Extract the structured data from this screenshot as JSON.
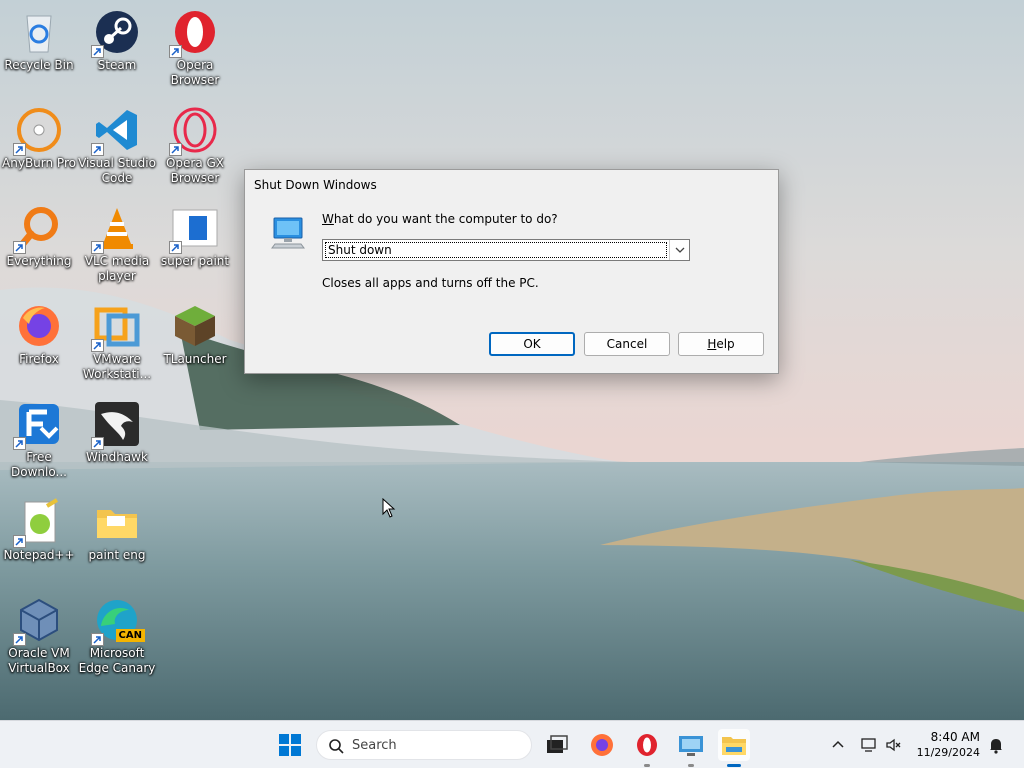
{
  "desktop": {
    "icons": [
      {
        "label": "Recycle Bin"
      },
      {
        "label": "Steam"
      },
      {
        "label": "Opera Browser"
      },
      {
        "label": "AnyBurn Pro"
      },
      {
        "label": "Visual Studio Code"
      },
      {
        "label": "Opera GX Browser"
      },
      {
        "label": "Everything"
      },
      {
        "label": "VLC media player"
      },
      {
        "label": "super paint"
      },
      {
        "label": "Firefox"
      },
      {
        "label": "VMware Workstati..."
      },
      {
        "label": "TLauncher"
      },
      {
        "label": "Free Downlo..."
      },
      {
        "label": "Windhawk"
      },
      {
        "label": "Notepad++"
      },
      {
        "label": "paint eng"
      },
      {
        "label": "Oracle VM VirtualBox"
      },
      {
        "label": "Microsoft Edge Canary"
      }
    ],
    "edge_badge": "CAN"
  },
  "dialog": {
    "title": "Shut Down Windows",
    "question_prefix": "W",
    "question_rest": "hat do you want the computer to do?",
    "selected_option": "Shut down",
    "description": "Closes all apps and turns off the PC.",
    "ok_label": "OK",
    "cancel_label": "Cancel",
    "help_prefix": "H",
    "help_rest": "elp",
    "accent_color": "#0067c0"
  },
  "taskbar": {
    "search_placeholder": "Search",
    "pinned": [
      "start-icon",
      "task-view-icon",
      "firefox-icon",
      "opera-icon",
      "remote-desktop-icon",
      "file-explorer-icon"
    ],
    "time": "8:40 AM",
    "date": "11/29/2024"
  }
}
